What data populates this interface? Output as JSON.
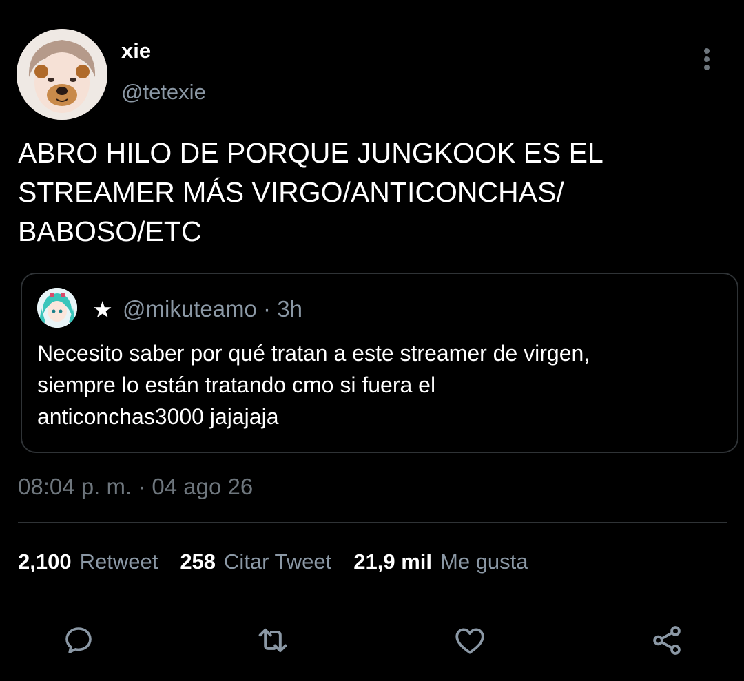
{
  "author": {
    "display_name": "xie",
    "handle": "@tetexie"
  },
  "tweet": {
    "text": "ABRO HILO DE PORQUE JUNGKOOK ES EL\nSTREAMER MÁS VIRGO/ANTICONCHAS/\nBABOSO/ETC",
    "timestamp": "08:04 p. m. · 04 ago 26"
  },
  "quote": {
    "name": "★",
    "handle_time": "@mikuteamo · 3h",
    "text": "Necesito saber por qué tratan a este streamer de virgen,\nsiempre lo están tratando cmo si fuera el\nanticonchas3000 jajajaja"
  },
  "stats": {
    "retweets_num": "2,100",
    "retweets_label": "Retweet",
    "quotes_num": "258",
    "quotes_label": "Citar Tweet",
    "likes_num": "21,9 mil",
    "likes_label": "Me gusta"
  },
  "icons": {
    "more": "more-vertical-icon",
    "reply": "reply-icon",
    "retweet": "retweet-icon",
    "like": "heart-icon",
    "share": "share-icon"
  },
  "colors": {
    "background": "#000000",
    "primary_text": "#ffffff",
    "secondary_text": "#8b98a5",
    "muted_text": "#6e767d",
    "border": "#2f3336"
  }
}
